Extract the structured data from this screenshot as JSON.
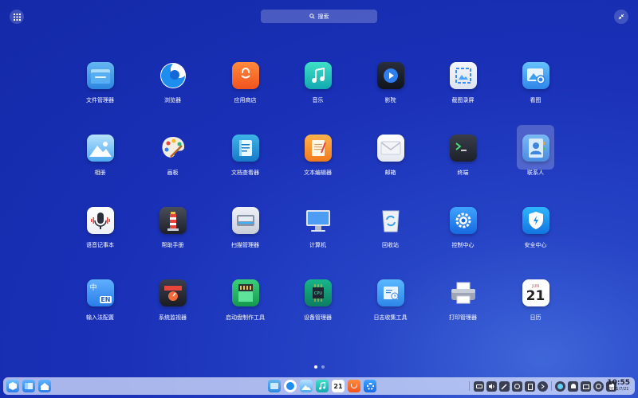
{
  "search": {
    "placeholder": "搜索"
  },
  "apps": [
    {
      "label": "文件管理器",
      "icon": "folder-icon"
    },
    {
      "label": "浏览器",
      "icon": "browser-icon"
    },
    {
      "label": "应用商店",
      "icon": "app-store-icon"
    },
    {
      "label": "音乐",
      "icon": "music-icon"
    },
    {
      "label": "影院",
      "icon": "movie-icon"
    },
    {
      "label": "截图录屏",
      "icon": "screenshot-icon"
    },
    {
      "label": "看图",
      "icon": "image-viewer-icon"
    },
    {
      "label": "相册",
      "icon": "album-icon"
    },
    {
      "label": "画板",
      "icon": "draw-palette-icon"
    },
    {
      "label": "文档查看器",
      "icon": "document-viewer-icon"
    },
    {
      "label": "文本编辑器",
      "icon": "text-editor-icon"
    },
    {
      "label": "邮箱",
      "icon": "mail-icon"
    },
    {
      "label": "终端",
      "icon": "terminal-icon"
    },
    {
      "label": "联系人",
      "icon": "contacts-icon"
    },
    {
      "label": "语音记事本",
      "icon": "voice-note-icon"
    },
    {
      "label": "帮助手册",
      "icon": "help-manual-icon"
    },
    {
      "label": "扫描管理器",
      "icon": "scanner-icon"
    },
    {
      "label": "计算机",
      "icon": "computer-icon"
    },
    {
      "label": "回收站",
      "icon": "trash-icon"
    },
    {
      "label": "控制中心",
      "icon": "control-center-icon"
    },
    {
      "label": "安全中心",
      "icon": "security-center-icon"
    },
    {
      "label": "输入法配置",
      "icon": "input-method-icon"
    },
    {
      "label": "系统监视器",
      "icon": "system-monitor-icon"
    },
    {
      "label": "启动盘制作工具",
      "icon": "boot-maker-icon"
    },
    {
      "label": "设备管理器",
      "icon": "device-manager-icon"
    },
    {
      "label": "日志收集工具",
      "icon": "log-collector-icon"
    },
    {
      "label": "打印管理器",
      "icon": "print-manager-icon"
    },
    {
      "label": "日历",
      "icon": "calendar-icon"
    }
  ],
  "selected_app": "联系人",
  "calendar_icon": {
    "month": "JUN",
    "day": "21"
  },
  "input_method_icon_text": "EN",
  "input_method_icon_char": "中",
  "pager": {
    "pages": 2,
    "current": 1
  },
  "clock": {
    "time": "10:55",
    "date": "2021/7/21"
  }
}
